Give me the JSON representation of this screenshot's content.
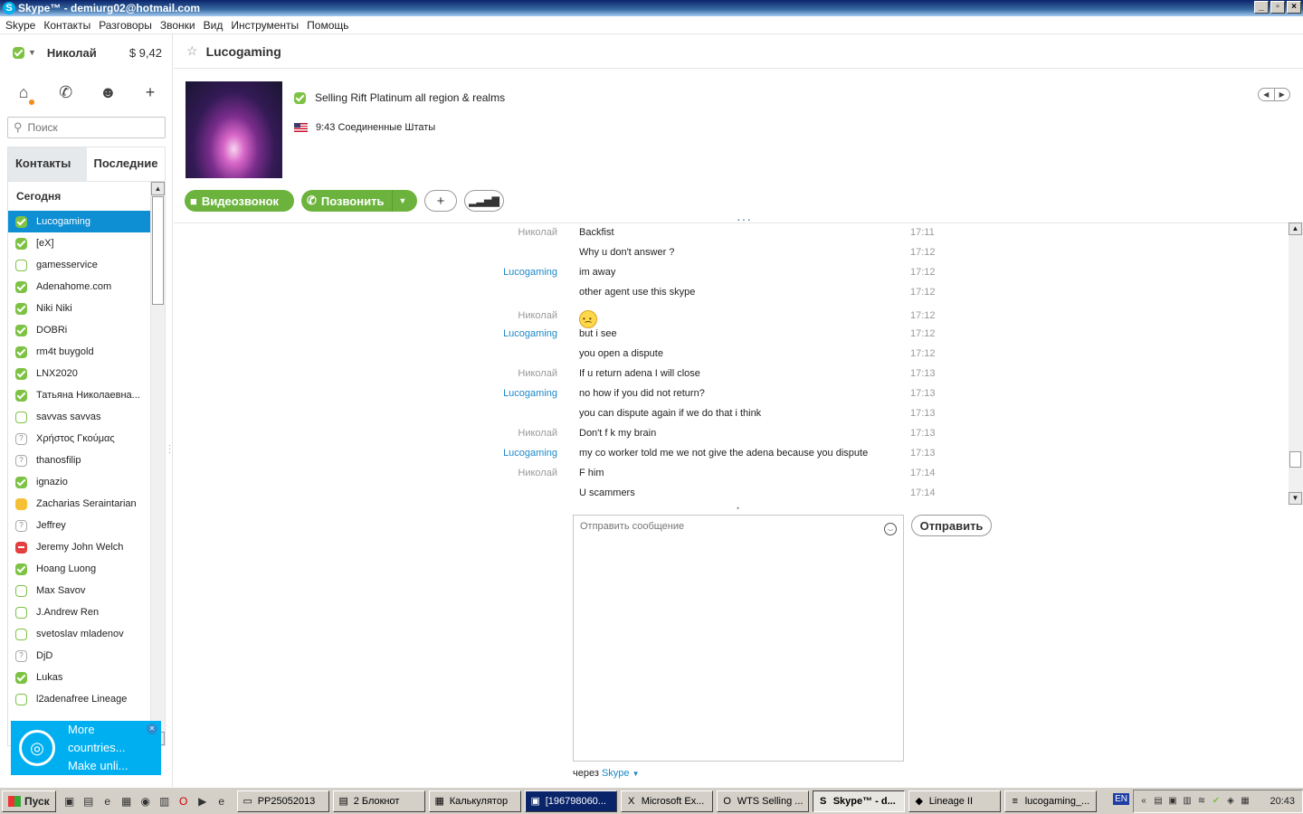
{
  "window": {
    "title": "Skype™ - demiurg02@hotmail.com"
  },
  "menu": [
    "Skype",
    "Контакты",
    "Разговоры",
    "Звонки",
    "Вид",
    "Инструменты",
    "Помощь"
  ],
  "profile": {
    "name": "Николай",
    "balance": "$ 9,42"
  },
  "search": {
    "placeholder": "Поиск"
  },
  "tabs": {
    "contacts": "Контакты",
    "recent": "Последние"
  },
  "contacts": {
    "section": "Сегодня",
    "items": [
      {
        "name": "Lucogaming",
        "status": "online",
        "active": true
      },
      {
        "name": "[eX]",
        "status": "online"
      },
      {
        "name": "gamesservice",
        "status": "offline"
      },
      {
        "name": "Adenahome.com",
        "status": "online"
      },
      {
        "name": "Niki Niki",
        "status": "online"
      },
      {
        "name": "DOBRi",
        "status": "online"
      },
      {
        "name": "rm4t buygold",
        "status": "online"
      },
      {
        "name": "LNX2020",
        "status": "online"
      },
      {
        "name": "Татьяна Николаевна...",
        "status": "online"
      },
      {
        "name": "savvas savvas",
        "status": "offline"
      },
      {
        "name": "Χρήστος Γκούμας",
        "status": "unknown"
      },
      {
        "name": "thanosfilip",
        "status": "unknown"
      },
      {
        "name": "ignazio",
        "status": "online"
      },
      {
        "name": "Zacharias Seraintarian",
        "status": "away"
      },
      {
        "name": "Jeffrey",
        "status": "unknown"
      },
      {
        "name": "Jeremy John Welch",
        "status": "dnd"
      },
      {
        "name": "Hoang Luong",
        "status": "online"
      },
      {
        "name": "Max Savov",
        "status": "offline"
      },
      {
        "name": "J.Andrew Ren",
        "status": "offline"
      },
      {
        "name": "svetoslav mladenov",
        "status": "offline"
      },
      {
        "name": "DjD",
        "status": "unknown"
      },
      {
        "name": "Lukas",
        "status": "online"
      },
      {
        "name": "l2adenafree Lineage",
        "status": "offline"
      }
    ]
  },
  "ad": {
    "line1": "More",
    "line2": "countries...",
    "line3": "Make unli..."
  },
  "chat": {
    "title": "Lucogaming",
    "mood": "Selling Rift Platinum all region & realms",
    "local_time": "9:43 Соединенные Штаты",
    "video_label": "Видеозвонок",
    "call_label": "Позвонить",
    "messages": [
      {
        "who": "Николай",
        "text": "Backfist",
        "time": "17:11"
      },
      {
        "who": "",
        "text": "Why u don't answer ?",
        "time": "17:12"
      },
      {
        "who": "Lucogaming",
        "text": "im away",
        "time": "17:12"
      },
      {
        "who": "",
        "text": "other agent use this skype",
        "time": "17:12"
      },
      {
        "who": "Николай",
        "text": "",
        "emoticon": "sad",
        "time": "17:12"
      },
      {
        "who": "Lucogaming",
        "text": "but i see",
        "time": "17:12"
      },
      {
        "who": "",
        "text": "you open a dispute",
        "time": "17:12"
      },
      {
        "who": "Николай",
        "text": "If u return adena I will close",
        "time": "17:13"
      },
      {
        "who": "Lucogaming",
        "text": "no how if you did not return?",
        "time": "17:13"
      },
      {
        "who": "",
        "text": "you can dispute again if we do that i think",
        "time": "17:13"
      },
      {
        "who": "Николай",
        "text": "Don't f    k my brain",
        "time": "17:13"
      },
      {
        "who": "Lucogaming",
        "text": "my co worker told me we not give the adena because you dispute",
        "time": "17:13"
      },
      {
        "who": "Николай",
        "text": "F      him",
        "time": "17:14"
      },
      {
        "who": "",
        "text": "U scammers",
        "time": "17:14"
      }
    ],
    "input_placeholder": "Отправить сообщение",
    "send_label": "Отправить",
    "via_prefix": "через",
    "via_service": "Skype"
  },
  "taskbar": {
    "start": "Пуск",
    "tasks": [
      {
        "label": "PP25052013",
        "icon": "folder-icon"
      },
      {
        "label": "2 Блокнот",
        "icon": "notepad-icon"
      },
      {
        "label": "Калькулятор",
        "icon": "calculator-icon"
      },
      {
        "label": "[196798060...",
        "icon": "window-icon",
        "highlight": true
      },
      {
        "label": "Microsoft Ex...",
        "icon": "excel-icon"
      },
      {
        "label": "WTS Selling ...",
        "icon": "opera-icon"
      },
      {
        "label": "Skype™ - d...",
        "icon": "skype-icon",
        "active": true
      },
      {
        "label": "Lineage II",
        "icon": "game-icon"
      },
      {
        "label": "lucogaming_...",
        "icon": "text-icon"
      }
    ],
    "lang": "EN",
    "clock": "20:43"
  },
  "colors": {
    "accent": "#0e8ed3",
    "call_green": "#6cb33e",
    "skype_blue": "#00aff0"
  }
}
